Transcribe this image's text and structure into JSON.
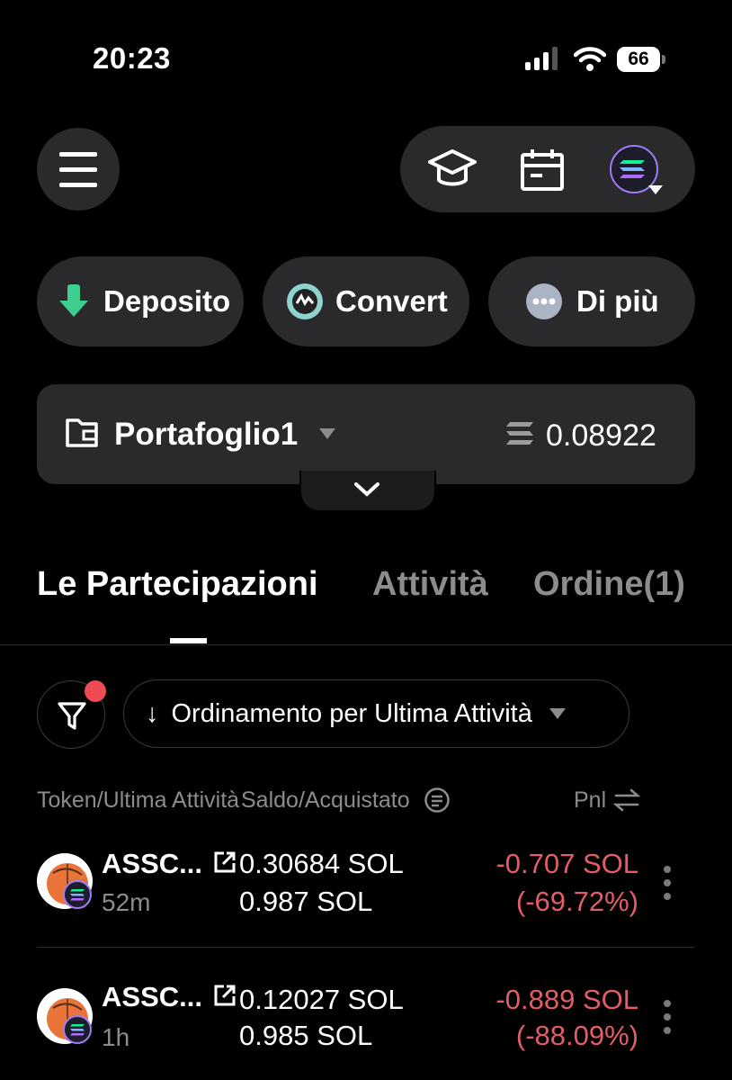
{
  "status_bar": {
    "time": "20:23",
    "battery": "66"
  },
  "actions": {
    "deposit": "Deposito",
    "convert": "Convert",
    "more": "Di più"
  },
  "wallet": {
    "name": "Portafoglio1",
    "balance": "0.08922"
  },
  "tabs": [
    {
      "label": "Le Partecipazioni",
      "active": true
    },
    {
      "label": "Attività",
      "active": false
    },
    {
      "label": "Ordine(1)",
      "active": false
    }
  ],
  "sort": {
    "label": "Ordinamento per Ultima Attività",
    "arrow": "↓"
  },
  "columns": {
    "token": "Token/Ultima Attività",
    "balance": "Saldo/Acquistato",
    "pnl": "Pnl"
  },
  "holdings": [
    {
      "name": "ASSC...",
      "time": "52m",
      "balance": "0.30684 SOL",
      "bought": "0.987 SOL",
      "pnl": "-0.707 SOL",
      "pnl_pct": "(-69.72%)"
    },
    {
      "name": "ASSC...",
      "time": "1h",
      "balance": "0.12027 SOL",
      "bought": "0.985 SOL",
      "pnl": "-0.889 SOL",
      "pnl_pct": "(-88.09%)"
    }
  ],
  "colors": {
    "background": "#000000",
    "surface": "#2a2a2c",
    "negative": "#e35d68",
    "muted": "#8c8c8e",
    "accent_green": "#3ecf8e"
  },
  "icons": [
    "menu-icon",
    "graduation-cap-icon",
    "calendar-icon",
    "solana-network-icon",
    "deposit-arrow-icon",
    "convert-icon",
    "more-dots-icon",
    "wallet-icon",
    "caret-down-icon",
    "solana-icon",
    "chevron-down-icon",
    "filter-icon",
    "swap-icon",
    "external-link-icon",
    "kebab-icon"
  ]
}
